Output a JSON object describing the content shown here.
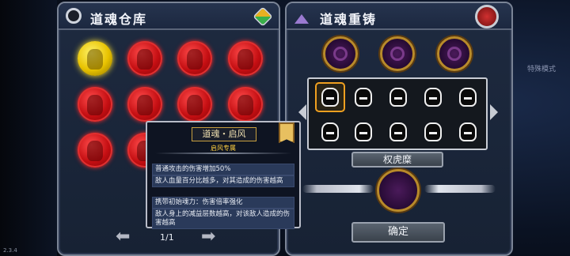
{
  "warehouse": {
    "title": "道魂仓库",
    "page": "1/1"
  },
  "reforge": {
    "title": "道魂重铸",
    "name_plate": "权虎糜",
    "confirm_label": "确定"
  },
  "tooltip": {
    "title": "道魂・启风",
    "subtitle": "启风专属",
    "effects": [
      "普通攻击的伤害增加50%",
      "敌人血量百分比越多，对其造成的伤害越高",
      "携带初始魂力：伤害倍率强化",
      "敌人身上的减益层数越高，对该敌人造成的伤害越高"
    ]
  },
  "background": {
    "mode_text": "特殊模式"
  },
  "version": "2.3.4",
  "colors": {
    "soul_red": "#c40e12",
    "soul_gold": "#e8c200",
    "panel": "#1e2a40",
    "accent": "#f0a020"
  },
  "icons": {
    "settings": "gear-ring-icon",
    "shop": "cube-shop-icon",
    "back": "back-arrow-icon",
    "forge": "anvil-icon",
    "badge": "gear-badge-icon"
  }
}
